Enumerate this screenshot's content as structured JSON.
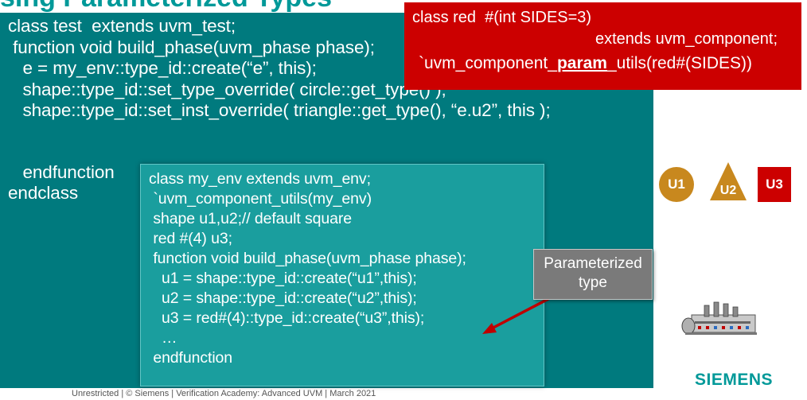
{
  "slide": {
    "title_fragment": "sing Parameterized Types",
    "main_code": {
      "lines": [
        "class test  extends uvm_test;",
        " function void build_phase(uvm_phase phase);",
        "   e = my_env::type_id::create(“e”, this);",
        "   shape::type_id::set_type_override( circle::get_type() );",
        "   shape::type_id::set_inst_override( triangle::get_type(), “e.u2”, this );",
        "",
        "   endfunction",
        "endclass"
      ]
    },
    "red_box": {
      "line1": "class red  #(int SIDES=3)",
      "line2": "extends uvm_component;",
      "line3_prefix": "`uvm_component_",
      "line3_bold": "param",
      "line3_suffix": "_utils(red#(SIDES))"
    },
    "env_code": {
      "lines": [
        "class my_env extends uvm_env;",
        " `uvm_component_utils(my_env)",
        " shape u1,u2;// default square",
        " red #(4) u3;",
        " function void build_phase(uvm_phase phase);",
        "   u1 = shape::type_id::create(“u1”,this);",
        "   u2 = shape::type_id::create(“u2”,this);",
        "   u3 = red#(4)::type_id::create(“u3”,this);",
        "   …",
        " endfunction"
      ]
    },
    "callout": {
      "line1": "Parameterized",
      "line2": "type"
    },
    "shapes": {
      "u1": "U1",
      "u2": "U2",
      "u3": "U3"
    },
    "colors": {
      "teal_panel": "#007a7e",
      "env_panel": "#1a9e9e",
      "red_box": "#cc0000",
      "u1": "#c8881e",
      "u3": "#cc0000",
      "siemens": "#009999"
    },
    "brand": "SIEMENS",
    "footer": "Unrestricted | © Siemens | Verification Academy: Advanced UVM | March 2021"
  }
}
